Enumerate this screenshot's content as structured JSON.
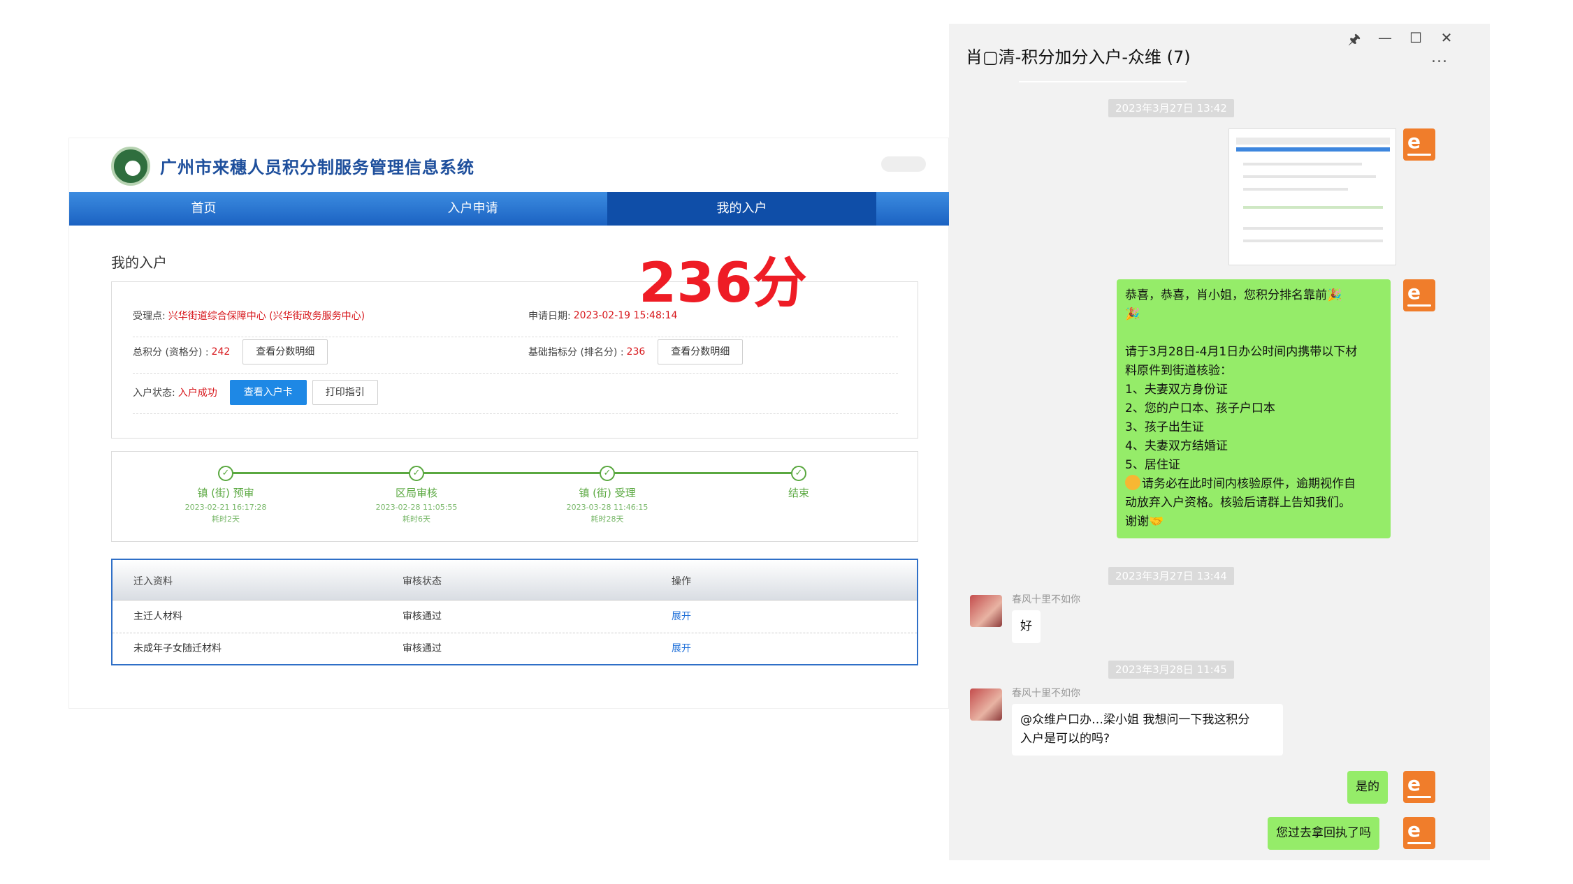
{
  "web": {
    "system_title": "广州市来穗人员积分制服务管理信息系统",
    "nav": [
      "首页",
      "入户申请",
      "我的入户"
    ],
    "page_title": "我的入户",
    "info": {
      "accept_label": "受理点:",
      "accept_value": "兴华街道综合保障中心 (兴华街政务服务中心)",
      "apply_date_label": "申请日期:",
      "apply_date_value": "2023-02-19 15:48:14",
      "total_label": "总积分 (资格分) :",
      "total_value": "242",
      "total_btn": "查看分数明细",
      "base_label": "基础指标分 (排名分) :",
      "base_value": "236",
      "base_btn": "查看分数明细",
      "status_label": "入户状态:",
      "status_value": "入户成功",
      "view_card_btn": "查看入户卡",
      "print_btn": "打印指引"
    },
    "big_score": "236分",
    "steps": [
      {
        "name": "镇 (街) 预审",
        "date": "2023-02-21 16:17:28",
        "elapsed": "耗时2天"
      },
      {
        "name": "区局审核",
        "date": "2023-02-28 11:05:55",
        "elapsed": "耗时6天"
      },
      {
        "name": "镇 (街) 受理",
        "date": "2023-03-28 11:46:15",
        "elapsed": "耗时28天"
      },
      {
        "name": "结束",
        "date": "",
        "elapsed": ""
      }
    ],
    "table": {
      "headers": [
        "迁入资料",
        "审核状态",
        "操作"
      ],
      "rows": [
        [
          "主迁人材料",
          "审核通过",
          "展开"
        ],
        [
          "未成年子女随迁材料",
          "审核通过",
          "展开"
        ]
      ]
    }
  },
  "chat": {
    "title": "肖▢清-积分加分入户-众维 (7)",
    "more": "...",
    "window_buttons": [
      "🖈",
      "—",
      "☐",
      "✕"
    ],
    "timestamps": [
      "2023年3月27日 13:42",
      "2023年3月27日 13:44",
      "2023年3月28日 11:45"
    ],
    "msg_congrats": [
      "恭喜，恭喜，肖小姐，您积分排名靠前🎉",
      "🎉",
      "",
      "请于3月28日-4月1日办公时间内携带以下材",
      "料原件到街道核验：",
      "1、夫妻双方身份证",
      "2、您的户口本、孩子户口本",
      "3、孩子出生证",
      "4、夫妻双方结婚证",
      "5、居住证",
      "请务必在此时间内核验原件，逾期视作自",
      "动放弃入户资格。核验后请群上告知我们。",
      "谢谢🤝"
    ],
    "sender_name": "春风十里不如你",
    "msg_ok": "好",
    "msg_question": [
      "@众维户口办…梁小姐 我想问一下我这积分",
      "入户是可以的吗?"
    ],
    "msg_yes": "是的",
    "msg_last": "您过去拿回执了吗"
  }
}
